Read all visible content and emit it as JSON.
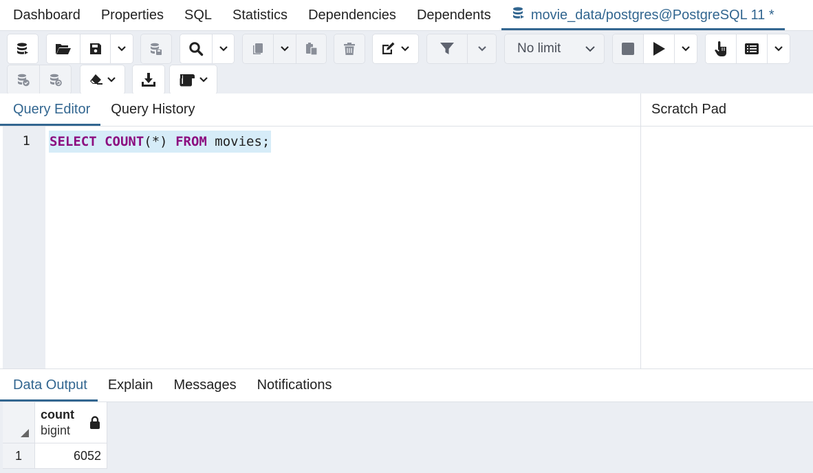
{
  "top_tabs": [
    {
      "label": "Dashboard"
    },
    {
      "label": "Properties"
    },
    {
      "label": "SQL"
    },
    {
      "label": "Statistics"
    },
    {
      "label": "Dependencies"
    },
    {
      "label": "Dependents"
    },
    {
      "label": "movie_data/postgres@PostgreSQL 11 *",
      "icon": "database-icon",
      "active": true
    }
  ],
  "toolbar": {
    "limit_label": "No limit",
    "icons": [
      "database-connect-icon",
      "open-folder-icon",
      "save-icon",
      "chevron-down-icon",
      "database-save-icon",
      "search-icon",
      "copy-icon",
      "paste-icon",
      "trash-icon",
      "edit-icon",
      "filter-icon",
      "stop-icon",
      "play-icon",
      "explain-icon",
      "list-icon",
      "commit-icon",
      "rollback-icon",
      "eraser-icon",
      "download-icon",
      "macros-icon"
    ]
  },
  "editor": {
    "tabs": [
      {
        "label": "Query Editor",
        "active": true
      },
      {
        "label": "Query History"
      }
    ],
    "line_number": "1",
    "code": {
      "kw1": "SELECT",
      "kw2": "COUNT",
      "args": "(*)",
      "kw3": "FROM",
      "table": "movies;"
    },
    "highlight_color": "#d6ecf8",
    "keyword_color": "#8c0e80"
  },
  "scratch": {
    "title": "Scratch Pad"
  },
  "results": {
    "tabs": [
      {
        "label": "Data Output",
        "active": true
      },
      {
        "label": "Explain"
      },
      {
        "label": "Messages"
      },
      {
        "label": "Notifications"
      }
    ],
    "columns": [
      {
        "name": "count",
        "type": "bigint",
        "icon": "lock-icon"
      }
    ],
    "rows": [
      {
        "row_number": "1",
        "values": [
          "6052"
        ]
      }
    ]
  },
  "colors": {
    "accent": "#326690",
    "toolbar_bg": "#ebeef3",
    "border": "#dde0e6"
  }
}
